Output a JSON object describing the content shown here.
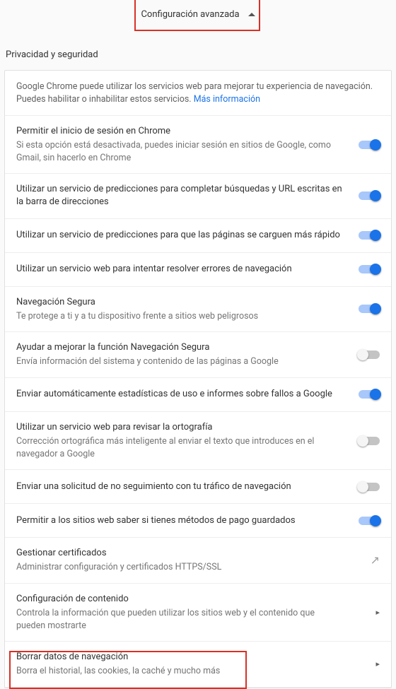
{
  "advanced_label": "Configuración avanzada",
  "section_title": "Privacidad y seguridad",
  "intro_text": "Google Chrome puede utilizar los servicios web para mejorar tu experiencia de navegación. Puedes habilitar o inhabilitar estos servicios. ",
  "intro_link": "Más información",
  "rows": {
    "signin": {
      "title": "Permitir el inicio de sesión en Chrome",
      "sub": "Si esta opción está desactivada, puedes iniciar sesión en sitios de Google, como Gmail, sin hacerlo en Chrome"
    },
    "predictions_url": {
      "title": "Utilizar un servicio de predicciones para completar búsquedas y URL escritas en la barra de direcciones"
    },
    "predictions_fast": {
      "title": "Utilizar un servicio de predicciones para que las páginas se carguen más rápido"
    },
    "nav_errors": {
      "title": "Utilizar un servicio web para intentar resolver errores de navegación"
    },
    "safe_browsing": {
      "title": "Navegación Segura",
      "sub": "Te protege a ti y a tu dispositivo frente a sitios web peligrosos"
    },
    "improve_sb": {
      "title": "Ayudar a mejorar la función Navegación Segura",
      "sub": "Envía información del sistema y contenido de las páginas a Google"
    },
    "usage_stats": {
      "title": "Enviar automáticamente estadísticas de uso e informes sobre fallos a Google"
    },
    "spellcheck": {
      "title": "Utilizar un servicio web para revisar la ortografía",
      "sub": "Corrección ortográfica más inteligente al enviar el texto que introduces en el navegador a Google"
    },
    "dnt": {
      "title": "Enviar una solicitud de no seguimiento con tu tráfico de navegación"
    },
    "payment": {
      "title": "Permitir a los sitios web saber si tienes métodos de pago guardados"
    },
    "certs": {
      "title": "Gestionar certificados",
      "sub": "Administrar configuración y certificados HTTPS/SSL"
    },
    "content": {
      "title": "Configuración de contenido",
      "sub": "Controla la información que pueden utilizar los sitios web y el contenido que pueden mostrarte"
    },
    "clear": {
      "title": "Borrar datos de navegación",
      "sub": "Borra el historial, las cookies, la caché y mucho más"
    }
  }
}
